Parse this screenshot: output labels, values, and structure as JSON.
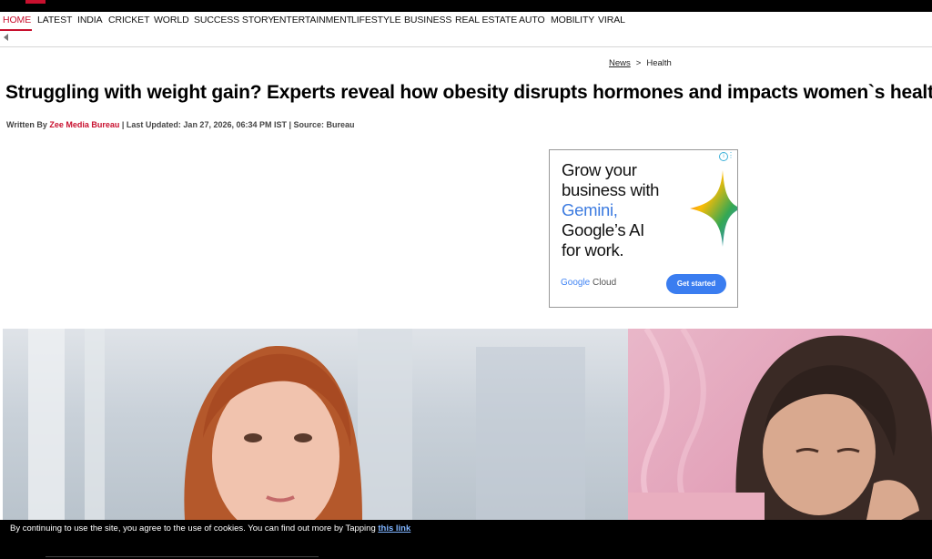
{
  "nav": {
    "items": [
      "HOME",
      "LATEST",
      "INDIA",
      "CRICKET",
      "WORLD",
      "SUCCESS STORY",
      "ENTERTAINMENT",
      "LIFESTYLE",
      "BUSINESS",
      "REAL ESTATE",
      "AUTO",
      "MOBILITY",
      "VIRAL"
    ],
    "active": "HOME",
    "accent_color": "#c8102e"
  },
  "breadcrumb": {
    "link": "News",
    "separator": ">",
    "current": "Health"
  },
  "article": {
    "headline": "Struggling with weight gain? Experts reveal how obesity disrupts hormones and impacts women`s health",
    "written_by_label": "Written By",
    "author": "Zee Media Bureau",
    "last_updated": "| Last Updated: Jan 27, 2026, 06:34 PM IST | Source: Bureau"
  },
  "ad": {
    "line1": "Grow your",
    "line2": "business with",
    "line3": "Gemini,",
    "line4": "Google’s AI",
    "line5": "for work.",
    "brand_google": "Google",
    "brand_cloud": " Cloud",
    "cta": "Get started",
    "icons": [
      "info-icon",
      "more-options-icon",
      "gemini-sparkle-icon"
    ]
  },
  "cookie": {
    "text": "By continuing to use the site, you agree to the use of cookies. You can find out more by Tapping ",
    "link": "this link"
  }
}
